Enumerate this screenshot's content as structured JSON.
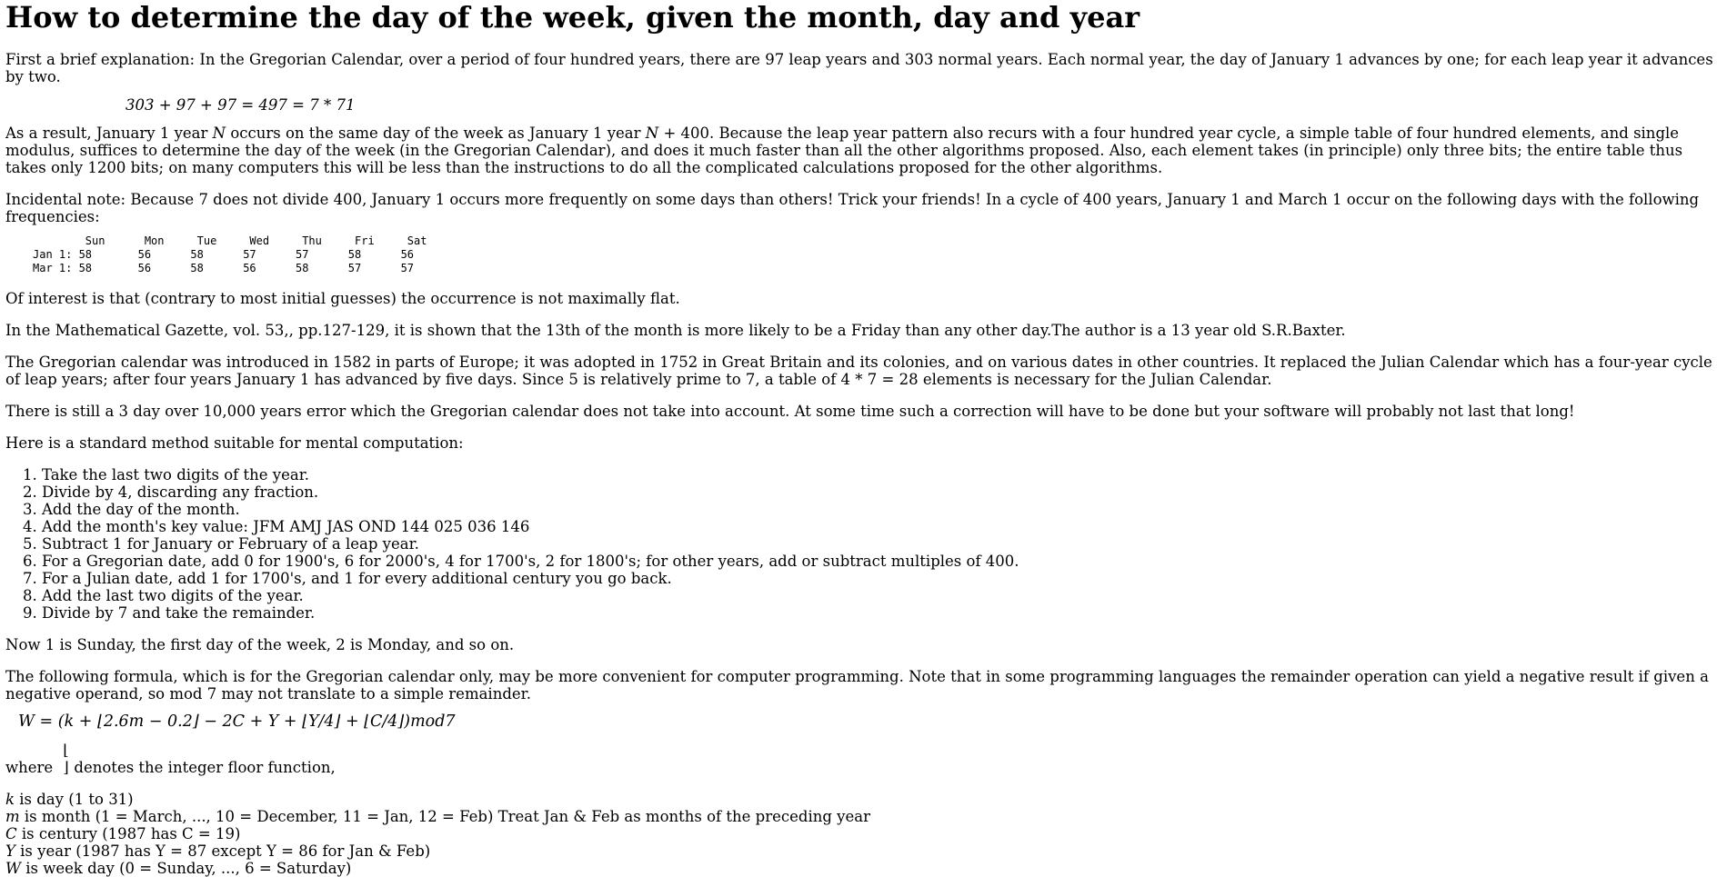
{
  "title": "How to determine the day of the week, given the month, day and year",
  "intro": "First a brief explanation: In the Gregorian Calendar, over a period of four hundred years, there are 97 leap years and 303 normal years. Each normal year, the day of January 1 advances by one; for each leap year it advances by two.",
  "equation1": "303 + 97 + 97 = 497 = 7 * 71",
  "result_para": {
    "pre": "As a result, January 1 year ",
    "var1": "N",
    "mid": " occurs on the same day of the week as January 1 year ",
    "var2": "N",
    "post": " + 400. Because the leap year pattern also recurs with a four hundred year cycle, a simple table of four hundred elements, and single modulus, suffices to determine the day of the week (in the Gregorian Calendar), and does it much faster than all the other algorithms proposed. Also, each element takes (in principle) only three bits; the entire table thus takes only 1200 bits; on many computers this will be less than the instructions to do all the complicated calculations proposed for the other algorithms."
  },
  "incidental": "Incidental note: Because 7 does not divide 400, January 1 occurs more frequently on some days than others! Trick your friends! In a cycle of 400 years, January 1 and March 1 occur on the following days with the following frequencies:",
  "frequency_table": "        Sun      Mon     Tue     Wed     Thu     Fri     Sat\nJan 1: 58       56      58      57      57      58      56\nMar 1: 58       56      58      56      58      57      57",
  "interest": "Of interest is that (contrary to most initial guesses) the occurrence is not maximally flat.",
  "gazette": "In the Mathematical Gazette, vol. 53,, pp.127-129, it is shown that the 13th of the month is more likely to be a Friday than any other day.The author is a 13 year old S.R.Baxter.",
  "gregorian": "The Gregorian calendar was introduced in 1582 in parts of Europe; it was adopted in 1752 in Great Britain and its colonies, and on various dates in other countries. It replaced the Julian Calendar which has a four-year cycle of leap years; after four years January 1 has advanced by five days. Since 5 is relatively prime to 7, a table of 4 * 7 = 28 elements is necessary for the Julian Calendar.",
  "error_note": "There is still a 3 day over 10,000 years error which the Gregorian calendar does not take into account. At some time such a correction will have to be done but your software will probably not last that long!",
  "method_intro": "Here is a standard method suitable for mental computation:",
  "steps": [
    "Take the last two digits of the year.",
    "Divide by 4, discarding any fraction.",
    "Add the day of the month.",
    "Add the month's key value: JFM AMJ JAS OND 144 025 036 146",
    "Subtract 1 for January or February of a leap year.",
    "For a Gregorian date, add 0 for 1900's, 6 for 2000's, 4 for 1700's, 2 for 1800's; for other years, add or subtract multiples of 400.",
    "For a Julian date, add 1 for 1700's, and 1 for every additional century you go back.",
    "Add the last two digits of the year.",
    "Divide by 7 and take the remainder."
  ],
  "sunday_note": "Now 1 is Sunday, the first day of the week, 2 is Monday, and so on.",
  "formula_intro": "The following formula, which is for the Gregorian calendar only, may be more convenient for computer programming. Note that in some programming languages the remainder operation can yield a negative result if given a negative operand, so mod 7 may not translate to a simple remainder.",
  "formula": "W = (k + ⌊2.6m − 0.2⌋ − 2C + Y + ⌊Y/4⌋ + ⌊C/4⌋)mod7",
  "floor_note": {
    "pre": "where ",
    "symbol": "⌊ ⌋",
    "post": "denotes the integer floor function,"
  },
  "definitions": [
    {
      "var": "k",
      "text": " is day (1 to 31)"
    },
    {
      "var": "m",
      "text": " is month (1 = March, ..., 10 = December, 11 = Jan, 12 = Feb) Treat Jan & Feb as months of the preceding year"
    },
    {
      "var": "C",
      "text": " is century (1987 has C = 19)"
    },
    {
      "var": "Y",
      "text": " is year (1987 has Y = 87 except Y = 86 for Jan & Feb)"
    },
    {
      "var": "W",
      "text": " is week day (0 = Sunday, ..., 6 = Saturday)"
    }
  ]
}
